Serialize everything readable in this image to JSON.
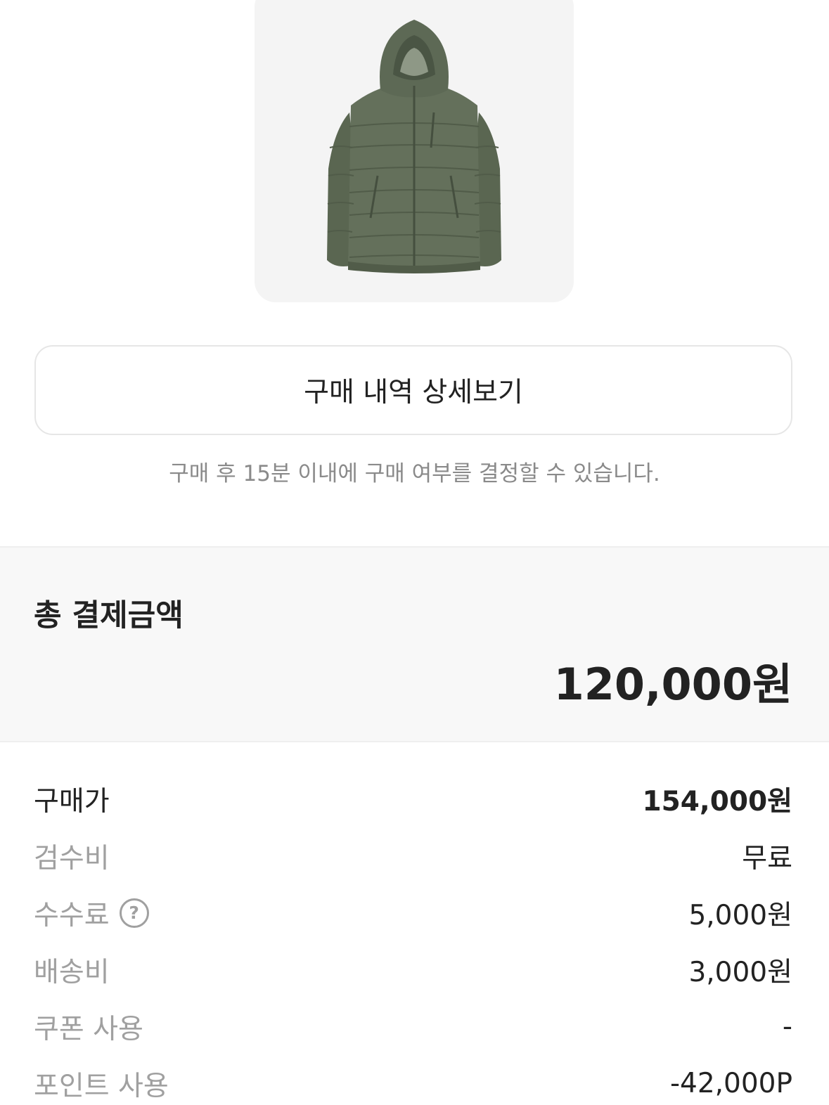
{
  "product": {
    "image_icon": "puffer-jacket-image"
  },
  "detail_button_label": "구매 내역 상세보기",
  "notice_text": "구매 후 15분 이내에 구매 여부를 결정할 수 있습니다.",
  "total": {
    "label": "총 결제금액",
    "value": "120,000원"
  },
  "breakdown": {
    "purchase_price": {
      "label": "구매가",
      "value": "154,000원"
    },
    "inspection_fee": {
      "label": "검수비",
      "value": "무료"
    },
    "commission": {
      "label": "수수료",
      "value": "5,000원",
      "help_icon": "question-circle-icon",
      "help_glyph": "?"
    },
    "shipping": {
      "label": "배송비",
      "value": "3,000원"
    },
    "coupon": {
      "label": "쿠폰 사용",
      "value": "-"
    },
    "points": {
      "label": "포인트 사용",
      "value": "-42,000P"
    }
  },
  "colors": {
    "jacket": "#5e6b55",
    "muted_text": "#a0a0a0",
    "primary_text": "#222222",
    "section_bg": "#f8f8f8"
  }
}
